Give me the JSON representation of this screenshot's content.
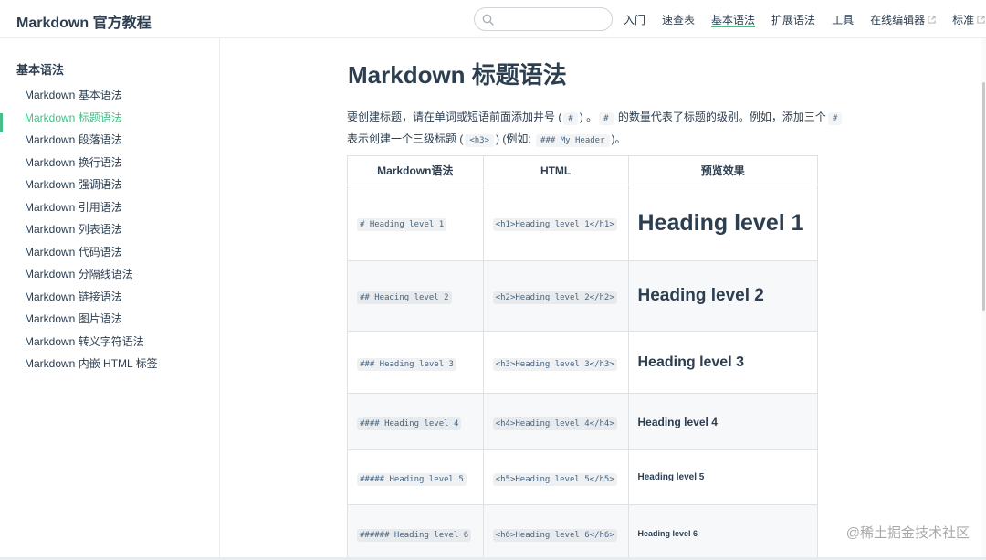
{
  "navbar": {
    "site_name": "Markdown 官方教程",
    "search": {
      "placeholder": "",
      "value": ""
    },
    "links": [
      {
        "label": "入门",
        "active": false,
        "external": false
      },
      {
        "label": "速查表",
        "active": false,
        "external": false
      },
      {
        "label": "基本语法",
        "active": true,
        "external": false
      },
      {
        "label": "扩展语法",
        "active": false,
        "external": false
      },
      {
        "label": "工具",
        "active": false,
        "external": false
      },
      {
        "label": "在线编辑器",
        "active": false,
        "external": true
      },
      {
        "label": "标准",
        "active": false,
        "external": true
      }
    ]
  },
  "sidebar": {
    "heading": "基本语法",
    "items": [
      {
        "label": "Markdown 基本语法"
      },
      {
        "label": "Markdown 标题语法"
      },
      {
        "label": "Markdown 段落语法"
      },
      {
        "label": "Markdown 换行语法"
      },
      {
        "label": "Markdown 强调语法"
      },
      {
        "label": "Markdown 引用语法"
      },
      {
        "label": "Markdown 列表语法"
      },
      {
        "label": "Markdown 代码语法"
      },
      {
        "label": "Markdown 分隔线语法"
      },
      {
        "label": "Markdown 链接语法"
      },
      {
        "label": "Markdown 图片语法"
      },
      {
        "label": "Markdown 转义字符语法"
      },
      {
        "label": "Markdown 内嵌 HTML 标签"
      }
    ],
    "active_index": 1
  },
  "main": {
    "title": "Markdown 标题语法",
    "intro": {
      "t1": "要创建标题，请在单词或短语前面添加井号 (",
      "c1": "#",
      "t2": ") 。",
      "c2": "#",
      "t3": "的数量代表了标题的级别。例如，添加三个",
      "c3": "#",
      "t4": "表示创建一个三级标题 (",
      "c4": "<h3>",
      "t5": ") (例如:",
      "c5": "### My Header",
      "t6": ")。"
    },
    "table": {
      "headers": [
        "Markdown语法",
        "HTML",
        "预览效果"
      ],
      "rows": [
        {
          "md": "# Heading level 1",
          "html": "<h1>Heading level 1</h1>",
          "preview": "Heading level 1"
        },
        {
          "md": "## Heading level 2",
          "html": "<h2>Heading level 2</h2>",
          "preview": "Heading level 2"
        },
        {
          "md": "### Heading level 3",
          "html": "<h3>Heading level 3</h3>",
          "preview": "Heading level 3"
        },
        {
          "md": "#### Heading level 4",
          "html": "<h4>Heading level 4</h4>",
          "preview": "Heading level 4"
        },
        {
          "md": "##### Heading level 5",
          "html": "<h5>Heading level 5</h5>",
          "preview": "Heading level 5"
        },
        {
          "md": "###### Heading level 6",
          "html": "<h6>Heading level 6</h6>",
          "preview": "Heading level 6"
        }
      ]
    }
  },
  "watermark": "@稀土掘金技术社区",
  "colors": {
    "accent": "#46bd87",
    "text": "#2c3e50",
    "code_text": "#476582",
    "border": "#dfe2e5",
    "row_alt": "#f6f8fa"
  }
}
